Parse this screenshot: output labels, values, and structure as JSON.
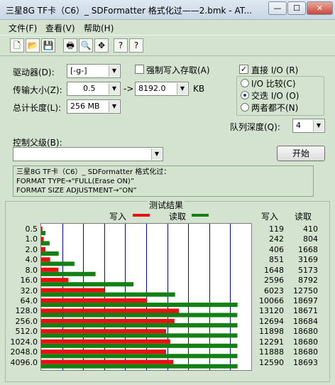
{
  "window": {
    "title": "三星8G TF卡（C6）_ SDFormatter 格式化过——2.bmk - AT...",
    "min_label": "—",
    "max_label": "☐",
    "close_label": "✕"
  },
  "menu": [
    "文件(F)",
    "查看(V)",
    "帮助(H)"
  ],
  "toolbar": {
    "icons": [
      "new-icon",
      "open-icon",
      "save-icon",
      "print-icon",
      "print-preview-icon",
      "move-icon",
      "help-icon",
      "context-help-icon"
    ],
    "glyphs": [
      "🗋",
      "📂",
      "💾",
      "🖶",
      "🔍",
      "✥",
      "?",
      "?"
    ]
  },
  "settings": {
    "drive_label": "驱动器(D):",
    "drive_value": "[-g-]",
    "force_write_label": "强制写入存取(A)",
    "force_write_checked": false,
    "direct_io_label": "直接 I/O (R)",
    "direct_io_checked": true,
    "transfer_label": "传输大小(Z):",
    "transfer_from": "0.5",
    "transfer_to_label": "-> ",
    "transfer_to": "8192.0",
    "transfer_unit": "KB",
    "io_compare_label": "I/O 比较(C)",
    "overlap_label": "交迭 I/O (O)",
    "neither_label": "两者都不(N)",
    "selected_io_mode": "overlap",
    "total_label": "总计长度(L):",
    "total_value": "256 MB",
    "queue_label": "队列深度(Q):",
    "queue_value": "4",
    "control_label": "控制父级(B):",
    "control_value": "",
    "start_label": "开始"
  },
  "description": {
    "lines": [
      "三星8G TF卡（C6）_ SDFormatter 格式化过：",
      "FORMAT TYPE→“FULL(Erase ON)”",
      "FORMAT SIZE ADJUSTMENT→“ON”"
    ]
  },
  "results": {
    "title": "测试结果",
    "write_label": "写入",
    "read_label": "读取",
    "col_write": "写入",
    "col_read": "读取",
    "colors": {
      "write": "#e81010",
      "read": "#128012",
      "grid": "#0a0a9a"
    }
  },
  "chart_data": {
    "type": "bar",
    "orientation": "horizontal",
    "title": "测试结果",
    "categories": [
      "0.5",
      "1.0",
      "2.0",
      "4.0",
      "8.0",
      "16.0",
      "32.0",
      "64.0",
      "128.0",
      "256.0",
      "512.0",
      "1024.0",
      "2048.0",
      "4096.0"
    ],
    "series": [
      {
        "name": "写入",
        "values": [
          119,
          242,
          406,
          851,
          1648,
          2596,
          6023,
          10066,
          13120,
          12694,
          11898,
          12291,
          11888,
          12590
        ]
      },
      {
        "name": "读取",
        "values": [
          410,
          804,
          1668,
          3169,
          5173,
          8792,
          12750,
          18697,
          18671,
          18684,
          18680,
          18680,
          18680,
          18693
        ]
      }
    ],
    "xlim": [
      0,
      20000
    ],
    "grid": true
  }
}
